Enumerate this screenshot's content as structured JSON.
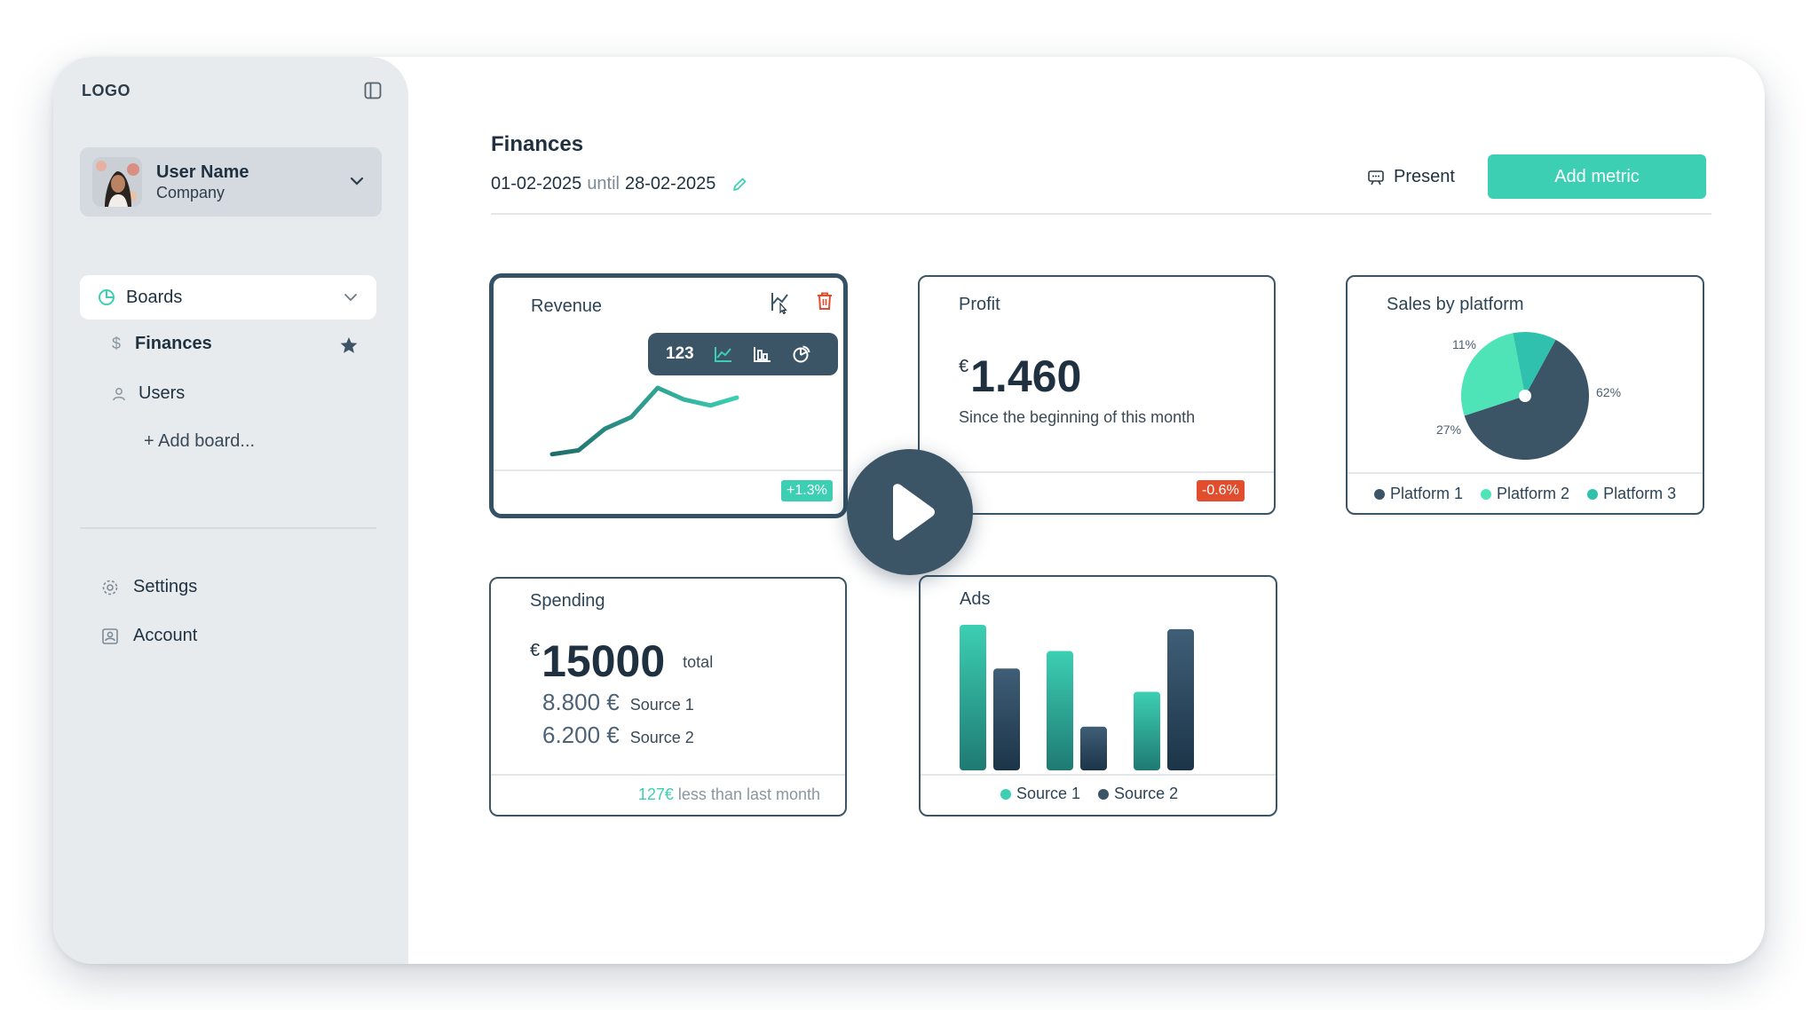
{
  "sidebar": {
    "logo": "LOGO",
    "user": {
      "name": "User Name",
      "company": "Company"
    },
    "boards_label": "Boards",
    "items": [
      {
        "label": "Finances",
        "starred": true
      },
      {
        "label": "Users"
      }
    ],
    "add_board": "+ Add board...",
    "bottom": [
      {
        "label": "Settings",
        "icon": "gear-icon"
      },
      {
        "label": "Account",
        "icon": "account-icon"
      }
    ]
  },
  "header": {
    "title": "Finances",
    "date_from": "01-02-2025",
    "until": "until",
    "date_to": "28-02-2025",
    "present_label": "Present",
    "add_metric_label": "Add metric"
  },
  "colors": {
    "accent": "#3ccfb3",
    "navy": "#3b5567",
    "danger": "#e24d2e",
    "sidebar": "#e7ebee"
  },
  "cards": {
    "revenue": {
      "title": "Revenue",
      "toolbar_number": "123",
      "badge": "+1.3%",
      "line_values": [
        12,
        16,
        38,
        50,
        80,
        68,
        62,
        70
      ]
    },
    "profit": {
      "title": "Profit",
      "currency": "€",
      "value": "1.460",
      "note": "Since the beginning of this month",
      "badge": "-0.6%"
    },
    "sales": {
      "title": "Sales by platform",
      "slices": [
        {
          "name": "Platform 1",
          "value": 62,
          "label": "62%",
          "color": "#3b5567"
        },
        {
          "name": "Platform 2",
          "value": 27,
          "label": "27%",
          "color": "#4fe3b8"
        },
        {
          "name": "Platform 3",
          "value": 11,
          "label": "11%",
          "color": "#2fc1ad"
        }
      ]
    },
    "spending": {
      "title": "Spending",
      "currency": "€",
      "total": "15000",
      "total_label": "total",
      "sources": [
        {
          "amount": "8.800 €",
          "label": "Source 1"
        },
        {
          "amount": "6.200 €",
          "label": "Source 2"
        }
      ],
      "footer_highlight": "127€",
      "footer_text": " less than last month"
    },
    "ads": {
      "title": "Ads",
      "legend": [
        "Source 1",
        "Source 2"
      ]
    }
  },
  "chart_data": [
    {
      "type": "pie",
      "title": "Sales by platform",
      "categories": [
        "Platform 1",
        "Platform 2",
        "Platform 3"
      ],
      "values": [
        62,
        27,
        11
      ]
    },
    {
      "type": "bar",
      "title": "Ads",
      "categories": [
        "",
        "",
        ""
      ],
      "series": [
        {
          "name": "Source 1",
          "values": [
            100,
            82,
            54
          ]
        },
        {
          "name": "Source 2",
          "values": [
            70,
            30,
            97
          ]
        }
      ]
    }
  ]
}
